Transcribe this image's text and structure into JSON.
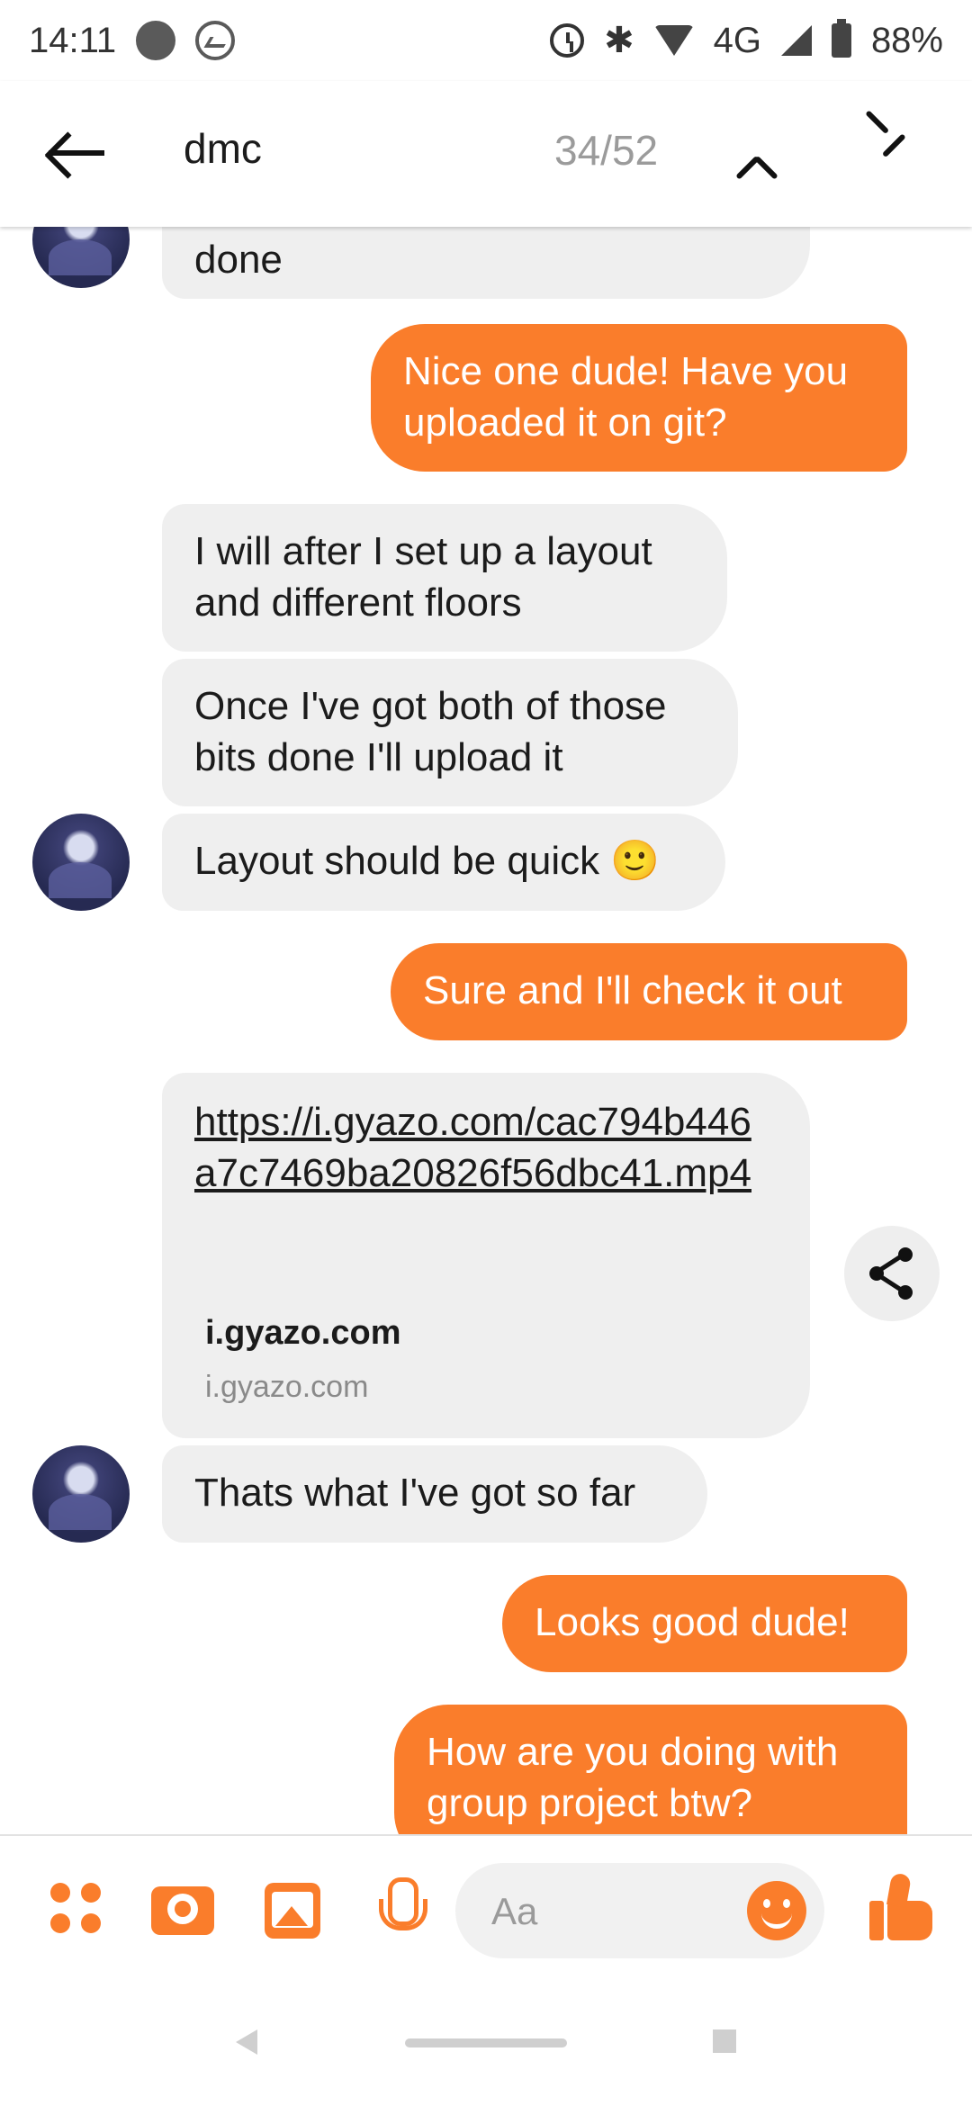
{
  "status_bar": {
    "time": "14:11",
    "network": "4G",
    "battery": "88%",
    "icons": [
      "record-dot-icon",
      "messenger-icon",
      "alarm-icon",
      "bluetooth-icon",
      "wifi-icon",
      "signal-icon",
      "battery-icon"
    ]
  },
  "header": {
    "search_term": "dmc",
    "match_counter": "34/52",
    "icons": [
      "back-arrow-icon",
      "chevron-up-icon",
      "chevron-down-icon"
    ]
  },
  "messages": [
    {
      "id": "m1",
      "side": "in",
      "text": "done"
    },
    {
      "id": "m2",
      "side": "out",
      "text": "Nice one dude! Have you uploaded it on git?"
    },
    {
      "id": "m3",
      "side": "in",
      "text": "I will after I set up a layout and different floors"
    },
    {
      "id": "m4",
      "side": "in",
      "text": "Once I've got both of those bits done I'll upload it"
    },
    {
      "id": "m5",
      "side": "in",
      "text": "Layout should be quick 🙂"
    },
    {
      "id": "m6",
      "side": "out",
      "text": "Sure and I'll check it out"
    },
    {
      "id": "m7",
      "side": "in",
      "type": "link",
      "url": "https://i.gyazo.com/cac794b446a7c7469ba20826f56dbc41.mp4",
      "host": "i.gyazo.com",
      "subhost": "i.gyazo.com"
    },
    {
      "id": "m8",
      "side": "in",
      "text": "Thats what I've got so far"
    },
    {
      "id": "m9",
      "side": "out",
      "text": "Looks good dude!"
    },
    {
      "id": "m10",
      "side": "out",
      "text": "How are you doing with group project btw?"
    }
  ],
  "composer": {
    "placeholder": "Aa",
    "accent_color": "#fa7d2b",
    "icons": [
      "more-apps-icon",
      "camera-icon",
      "gallery-icon",
      "microphone-icon",
      "emoji-icon",
      "thumbs-up-icon"
    ]
  },
  "colors": {
    "outgoing_bubble": "#fa7d2b",
    "incoming_bubble": "#efefef"
  }
}
